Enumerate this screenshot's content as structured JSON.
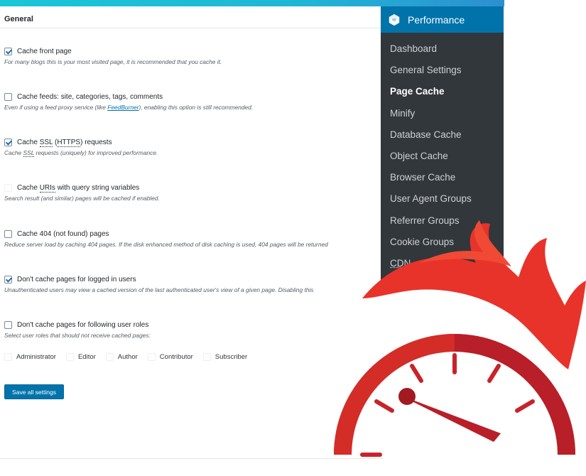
{
  "page": {
    "section_title": "General"
  },
  "options": [
    {
      "label": "Cache front page",
      "checked": true,
      "description": "For many blogs this is your most visited page, it is recommended that you cache it."
    },
    {
      "label": "Cache feeds: site, categories, tags, comments",
      "checked": false,
      "description_prefix": "Even if using a feed proxy service (like ",
      "description_link": "FeedBurner",
      "description_suffix": "), enabling this option is still recommended."
    },
    {
      "label_prefix": "Cache ",
      "label_abbr1": "SSL",
      "label_mid": " (",
      "label_abbr2": "HTTPS",
      "label_suffix": ") requests",
      "checked": true,
      "description_prefix": "Cache ",
      "description_abbr": "SSL",
      "description_suffix": " requests (uniquely) for improved performance."
    },
    {
      "label_prefix": "Cache ",
      "label_abbr": "URIs",
      "label_suffix": " with query string variables",
      "checked": false,
      "description": "Search result (and similar) pages will be cached if enabled."
    },
    {
      "label": "Cache 404 (not found) pages",
      "checked": false,
      "description": "Reduce server load by caching 404 pages. If the disk enhanced method of disk caching is used, 404 pages will be returned"
    },
    {
      "label": "Don't cache pages for logged in users",
      "checked": true,
      "description": "Unauthenticated users may view a cached version of the last authenticated user's view of a given page. Disabling this"
    },
    {
      "label": "Don't cache pages for following user roles",
      "checked": false,
      "description": "Select user roles that should not receive cached pages:"
    }
  ],
  "roles": [
    "Administrator",
    "Editor",
    "Author",
    "Contributor",
    "Subscriber"
  ],
  "save_button": "Save all settings",
  "sidebar": {
    "title": "Performance",
    "icon": "w3tc-cube-icon",
    "items": [
      {
        "label": "Dashboard"
      },
      {
        "label": "General Settings"
      },
      {
        "label": "Page Cache",
        "active": true
      },
      {
        "label": "Minify"
      },
      {
        "label": "Database Cache"
      },
      {
        "label": "Object Cache"
      },
      {
        "label": "Browser Cache"
      },
      {
        "label": "User Agent Groups"
      },
      {
        "label": "Referrer Groups"
      },
      {
        "label": "Cookie Groups"
      },
      {
        "label": "CDN"
      }
    ]
  },
  "colors": {
    "accent": "#0073aa",
    "sidebar_bg": "#32373c",
    "gauge_red": "#d42c27",
    "flame_red": "#e8332a"
  },
  "decor": {
    "gauge_icon": "speedometer-flame-icon"
  }
}
